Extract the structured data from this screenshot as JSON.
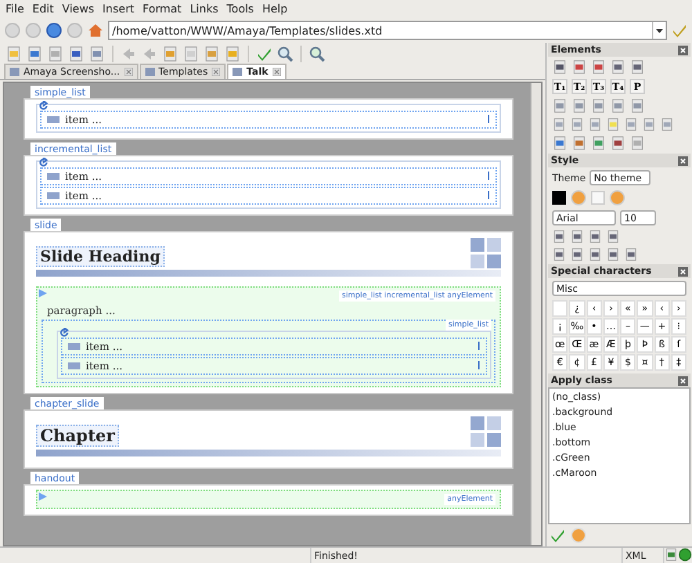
{
  "menu": [
    "File",
    "Edit",
    "Views",
    "Insert",
    "Format",
    "Links",
    "Tools",
    "Help"
  ],
  "address": "/home/vatton/WWW/Amaya/Templates/slides.xtd",
  "tabs": [
    {
      "label": "Amaya Screensho...",
      "selected": false
    },
    {
      "label": "Templates",
      "selected": false
    },
    {
      "label": "Talk",
      "selected": true
    }
  ],
  "blocks": [
    {
      "kind": "list",
      "label": "simple_list",
      "items": [
        "item ..."
      ]
    },
    {
      "kind": "list",
      "label": "incremental_list",
      "items": [
        "item ...",
        "item ..."
      ]
    },
    {
      "kind": "slide",
      "label": "slide",
      "heading": "Slide Heading",
      "hint": "simple_list incremental_list anyElement",
      "paragraph": "paragraph ...",
      "inner_label": "simple_list",
      "items": [
        "item ...",
        "item ..."
      ]
    },
    {
      "kind": "chapter",
      "label": "chapter_slide",
      "heading": "Chapter"
    },
    {
      "kind": "handout",
      "label": "handout",
      "hint": "anyElement"
    }
  ],
  "elements": {
    "title": "Elements",
    "headings": [
      "T₁",
      "T₂",
      "T₃",
      "T₄",
      "P"
    ]
  },
  "style": {
    "title": "Style",
    "theme_label": "Theme",
    "theme": "No theme",
    "font": "Arial",
    "size": "10"
  },
  "special": {
    "title": "Special characters",
    "category": "Misc",
    "chars": [
      "¿",
      "‹",
      "›",
      "«",
      "»",
      "‹",
      "›",
      "¡",
      "‰",
      "•",
      "…",
      "–",
      "—",
      "+",
      "⁝",
      "œ",
      "Œ",
      "æ",
      "Æ",
      "þ",
      "Þ",
      "ß",
      "ſ",
      "€",
      "¢",
      "£",
      "¥",
      "$",
      "¤",
      "†",
      "‡"
    ]
  },
  "classes": {
    "title": "Apply class",
    "items": [
      "(no_class)",
      ".background",
      ".blue",
      ".bottom",
      ".cGreen",
      ".cMaroon"
    ]
  },
  "status": {
    "message": "Finished!",
    "mode": "XML"
  }
}
